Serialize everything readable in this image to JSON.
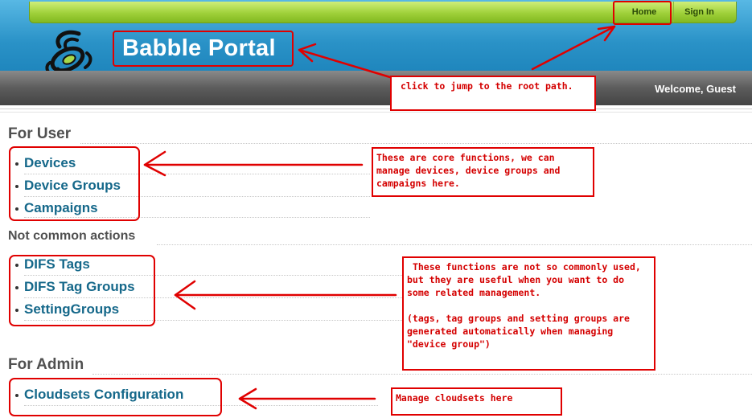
{
  "nav": {
    "home_label": "Home",
    "signin_label": "Sign In"
  },
  "header": {
    "site_title": "Babble Portal",
    "welcome": "Welcome, Guest"
  },
  "sections": {
    "user": {
      "title": "For User",
      "items": [
        "Devices",
        "Device Groups",
        "Campaigns"
      ]
    },
    "common": {
      "title": "Not common actions",
      "items": [
        "DIFS Tags",
        "DIFS Tag Groups",
        "SettingGroups"
      ]
    },
    "admin": {
      "title": "For Admin",
      "items": [
        "Cloudsets Configuration"
      ]
    }
  },
  "annotations": {
    "home": " click to jump to the root path.",
    "core": "These are core functions, we can manage devices, device groups and campaigns here.",
    "uncommon": " These functions are not so commonly used, but they are useful when you want to do some related management.\n\n(tags, tag groups and setting groups are generated automatically when managing \"device group\")",
    "cloudsets": "Manage cloudsets here"
  },
  "colors": {
    "accent_red": "#e00000",
    "link": "#15688a",
    "nav_green": "#9fd13a",
    "header_blue": "#2a92c7"
  }
}
